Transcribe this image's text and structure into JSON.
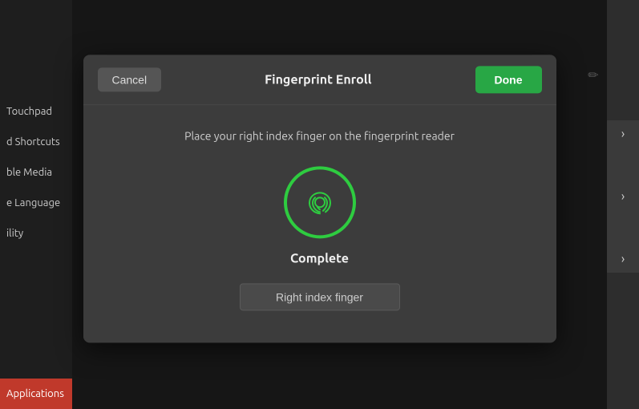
{
  "sidebar": {
    "items": [
      {
        "label": "Touchpad"
      },
      {
        "label": "d Shortcuts"
      },
      {
        "label": "ble Media"
      },
      {
        "label": "e Language"
      },
      {
        "label": "ility"
      },
      {
        "label": "Applications"
      }
    ]
  },
  "dialog": {
    "title": "Fingerprint Enroll",
    "cancel_label": "Cancel",
    "done_label": "Done",
    "instruction": "Place your right index finger on the fingerprint reader",
    "complete_label": "Complete",
    "finger_name": "Right index finger"
  },
  "arrows": [
    "›",
    "›",
    "›"
  ],
  "edit_icon": "✏"
}
